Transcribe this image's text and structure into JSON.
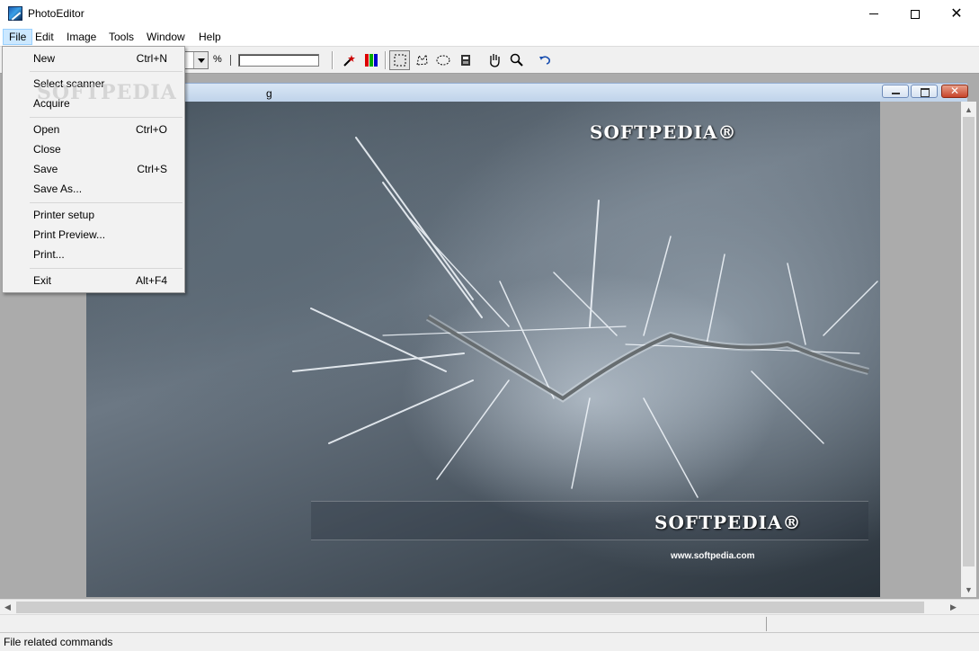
{
  "window": {
    "title": "PhotoEditor"
  },
  "menubar": {
    "items": [
      "File",
      "Edit",
      "Image",
      "Tools",
      "Window",
      "Help"
    ]
  },
  "toolbar": {
    "zoom_unit": "%"
  },
  "document": {
    "title_fragment": "g"
  },
  "watermark": {
    "brand": "SOFTPEDIA®",
    "url": "www.softpedia.com",
    "menu_overlay": "SOFTPEDIA"
  },
  "file_menu": {
    "groups": [
      [
        {
          "label": "New",
          "shortcut": "Ctrl+N"
        }
      ],
      [
        {
          "label": "Select scanner",
          "shortcut": ""
        },
        {
          "label": "Acquire",
          "shortcut": ""
        }
      ],
      [
        {
          "label": "Open",
          "shortcut": "Ctrl+O"
        },
        {
          "label": "Close",
          "shortcut": ""
        },
        {
          "label": "Save",
          "shortcut": "Ctrl+S"
        },
        {
          "label": "Save As...",
          "shortcut": ""
        }
      ],
      [
        {
          "label": "Printer setup",
          "shortcut": ""
        },
        {
          "label": "Print Preview...",
          "shortcut": ""
        },
        {
          "label": "Print...",
          "shortcut": ""
        }
      ],
      [
        {
          "label": "Exit",
          "shortcut": "Alt+F4"
        }
      ]
    ]
  },
  "status": {
    "text": "File related commands"
  }
}
